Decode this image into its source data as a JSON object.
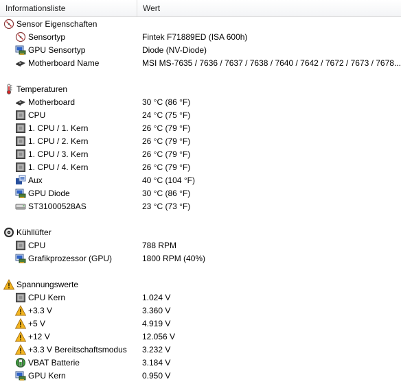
{
  "header": {
    "col1": "Informationsliste",
    "col2": "Wert"
  },
  "sections": [
    {
      "title": "Sensor Eigenschaften",
      "icon": "sensor-gauge-icon",
      "items": [
        {
          "label": "Sensortyp",
          "value": "Fintek F71889ED  (ISA 600h)",
          "icon": "sensor-gauge-icon"
        },
        {
          "label": "GPU Sensortyp",
          "value": "Diode  (NV-Diode)",
          "icon": "gpu-card-icon"
        },
        {
          "label": "Motherboard Name",
          "value": "MSI MS-7635 / 7636 / 7637 / 7638 / 7640 / 7642 / 7672 / 7673 / 7678...",
          "icon": "motherboard-icon"
        }
      ]
    },
    {
      "title": "Temperaturen",
      "icon": "thermometer-icon",
      "items": [
        {
          "label": "Motherboard",
          "value": "30 °C  (86 °F)",
          "icon": "motherboard-icon"
        },
        {
          "label": "CPU",
          "value": "24 °C  (75 °F)",
          "icon": "cpu-chip-icon"
        },
        {
          "label": "1. CPU / 1. Kern",
          "value": "26 °C  (79 °F)",
          "icon": "cpu-chip-icon"
        },
        {
          "label": "1. CPU / 2. Kern",
          "value": "26 °C  (79 °F)",
          "icon": "cpu-chip-icon"
        },
        {
          "label": "1. CPU / 3. Kern",
          "value": "26 °C  (79 °F)",
          "icon": "cpu-chip-icon"
        },
        {
          "label": "1. CPU / 4. Kern",
          "value": "26 °C  (79 °F)",
          "icon": "cpu-chip-icon"
        },
        {
          "label": "Aux",
          "value": "40 °C  (104 °F)",
          "icon": "aux-board-icon"
        },
        {
          "label": "GPU Diode",
          "value": "30 °C  (86 °F)",
          "icon": "gpu-card-icon"
        },
        {
          "label": "ST31000528AS",
          "value": "23 °C  (73 °F)",
          "icon": "hard-drive-icon"
        }
      ]
    },
    {
      "title": "Kühllüfter",
      "icon": "fan-icon",
      "items": [
        {
          "label": "CPU",
          "value": "788 RPM",
          "icon": "cpu-chip-icon"
        },
        {
          "label": "Grafikprozessor (GPU)",
          "value": "1800 RPM  (40%)",
          "icon": "gpu-card-icon"
        }
      ]
    },
    {
      "title": "Spannungswerte",
      "icon": "warning-icon",
      "items": [
        {
          "label": "CPU Kern",
          "value": "1.024 V",
          "icon": "cpu-chip-icon"
        },
        {
          "label": "+3.3 V",
          "value": "3.360 V",
          "icon": "warning-icon"
        },
        {
          "label": "+5 V",
          "value": "4.919 V",
          "icon": "warning-icon"
        },
        {
          "label": "+12 V",
          "value": "12.056 V",
          "icon": "warning-icon"
        },
        {
          "label": "+3.3 V Bereitschaftsmodus",
          "value": "3.232 V",
          "icon": "warning-icon"
        },
        {
          "label": "VBAT Batterie",
          "value": "3.184 V",
          "icon": "battery-icon"
        },
        {
          "label": "GPU Kern",
          "value": "0.950 V",
          "icon": "gpu-card-icon"
        }
      ]
    }
  ]
}
